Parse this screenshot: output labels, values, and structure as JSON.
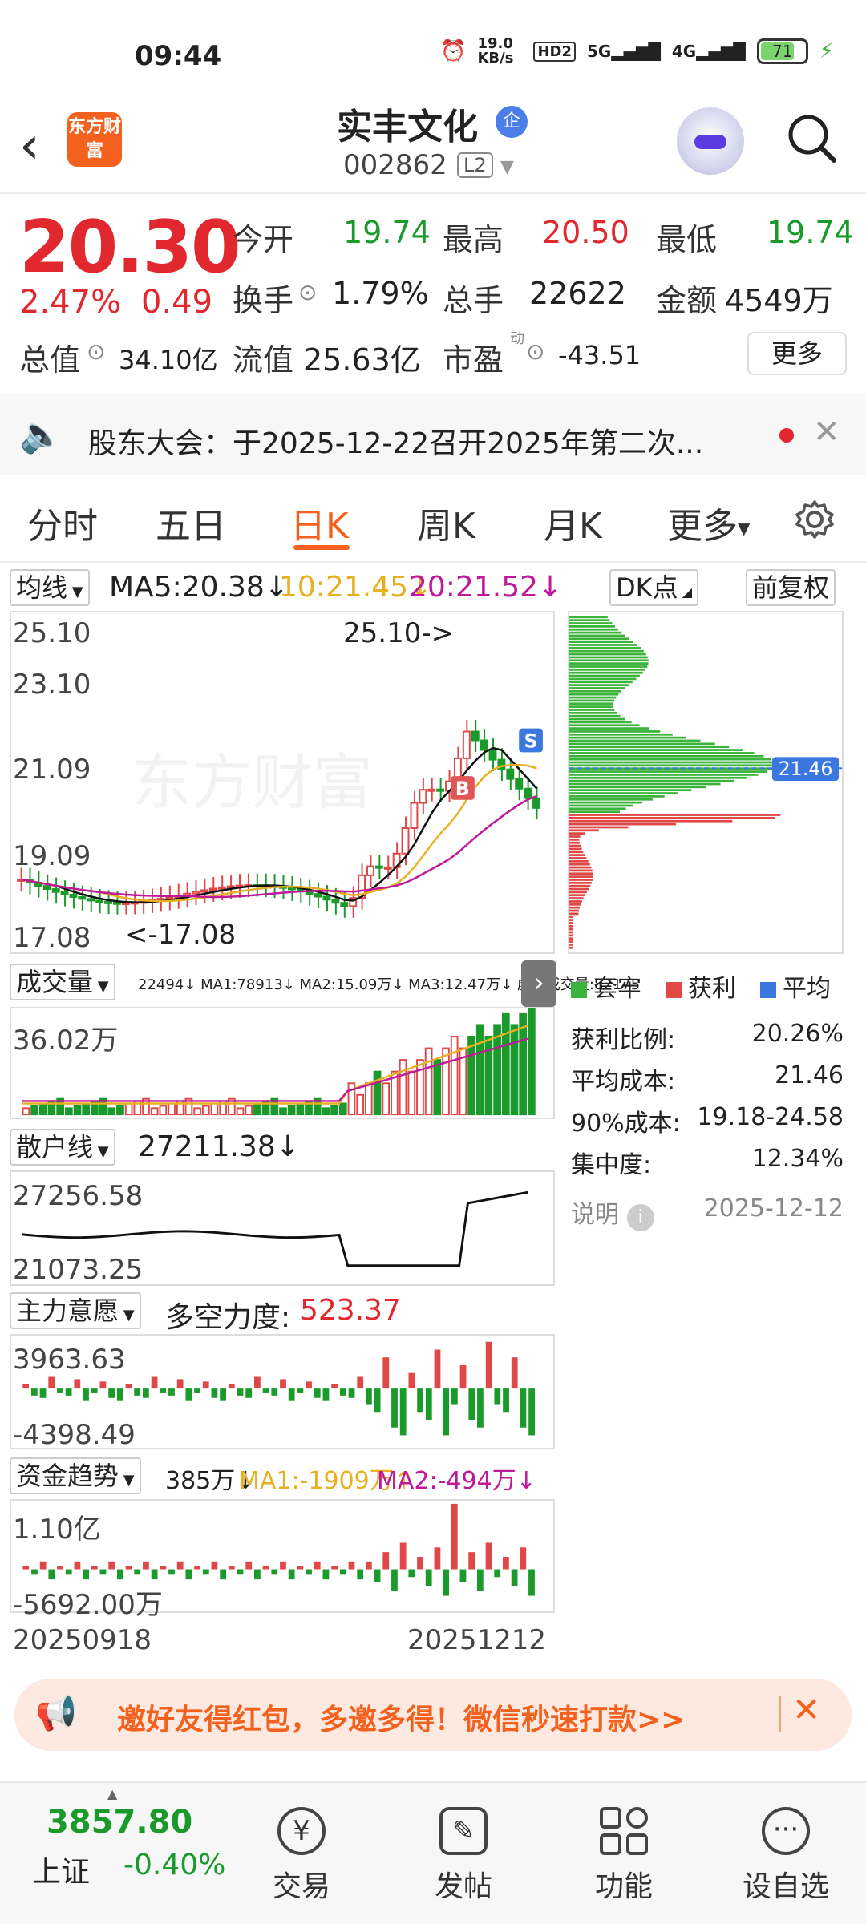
{
  "status_bar": {
    "time": "09:44",
    "net_speed": "19.0 KB/s",
    "hd": "HD2",
    "sig1": "5G",
    "sig2": "4G",
    "battery": "71"
  },
  "header": {
    "logo": "东方财富",
    "stock_name": "实丰文化",
    "tag": "企",
    "code": "002862",
    "level": "L2"
  },
  "quote": {
    "price": "20.30",
    "change_pct": "2.47%",
    "change_abs": "0.49",
    "open_label": "今开",
    "open": "19.74",
    "high_label": "最高",
    "high": "20.50",
    "low_label": "最低",
    "low": "19.74",
    "turnover_label": "换手",
    "turnover": "1.79%",
    "volume_label": "总手",
    "volume": "22622",
    "amount_label": "金额",
    "amount": "4549万",
    "mktcap_label": "总值",
    "mktcap": "34.10亿",
    "float_label": "流值",
    "float": "25.63亿",
    "pe_label": "市盈",
    "pe_sup": "动",
    "pe": "-43.51",
    "more": "更多"
  },
  "notice": {
    "text": "股东大会：于2025-12-22召开2025年第二次..."
  },
  "tabs": [
    "分时",
    "五日",
    "日K",
    "周K",
    "月K",
    "更多"
  ],
  "active_tab": "日K",
  "kline": {
    "ma_selector": "均线",
    "ma5": "MA5:20.38↓",
    "ma10": "10:21.45↓",
    "ma20": "20:21.52↓",
    "dk_btn": "DK点",
    "adjust_btn": "前复权",
    "y_labels": [
      "25.10",
      "23.10",
      "21.09",
      "19.09",
      "17.08"
    ],
    "max_label": "25.10->",
    "min_label": "<-17.08",
    "buy_marker": "B",
    "sell_marker": "S",
    "watermark": "东方财富"
  },
  "volume_panel": {
    "selector": "成交量",
    "stats": "22494↓ MA1:78913↓ MA2:15.09万↓ MA3:12.47万↓ 虚拟成交量:82175",
    "y_top": "36.02万"
  },
  "retail_panel": {
    "selector": "散户线",
    "value": "27211.38↓",
    "y_top": "27256.58",
    "y_bottom": "21073.25"
  },
  "main_panel": {
    "selector": "主力意愿",
    "label": "多空力度:",
    "value": "523.37",
    "y_top": "3963.63",
    "y_bottom": "-4398.49"
  },
  "fund_panel": {
    "selector": "资金趋势",
    "v1": "385万↓",
    "ma1": "MA1:-1909万↑",
    "ma2": "MA2:-494万↓",
    "y_top": "1.10亿",
    "y_bottom": "-5692.00万"
  },
  "dates": {
    "start": "20250918",
    "end": "20251212"
  },
  "distribution": {
    "avg_label": "21.46",
    "legend": [
      "套牢",
      "获利",
      "平均"
    ],
    "legend_colors": [
      "#3cb43c",
      "#e04848",
      "#3a78e0"
    ],
    "stats": [
      {
        "label": "获利比例:",
        "value": "20.26%"
      },
      {
        "label": "平均成本:",
        "value": "21.46"
      },
      {
        "label": "90%成本:",
        "value": "19.18-24.58"
      },
      {
        "label": "集中度:",
        "value": "12.34%"
      }
    ],
    "note_label": "说明",
    "note_date": "2025-12-12"
  },
  "banner": {
    "text": "邀好友得红包，多邀多得！微信秒速打款>>"
  },
  "bottom_nav": {
    "index_value": "3857.80",
    "index_name": "上证",
    "index_change": "-0.40%",
    "items": [
      "交易",
      "发帖",
      "功能",
      "设自选"
    ]
  }
}
